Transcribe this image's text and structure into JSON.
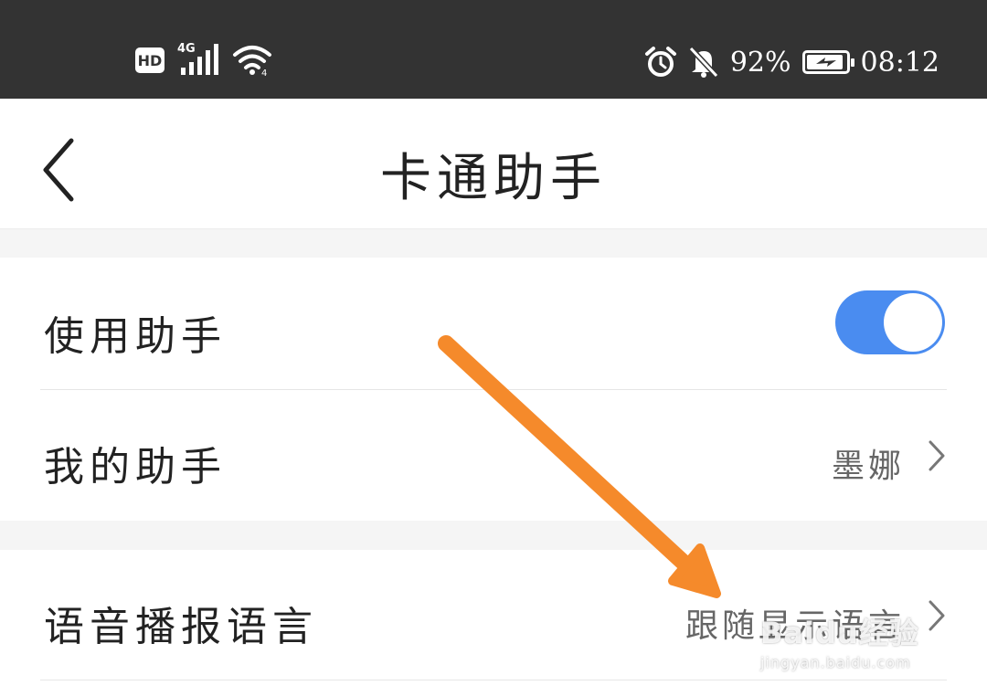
{
  "status_bar": {
    "hd_label": "HD",
    "network_label": "4G",
    "battery_percent": "92%",
    "time": "08:12",
    "icons": [
      "hd-icon",
      "signal-icon",
      "wifi-icon",
      "alarm-icon",
      "mute-icon",
      "battery-charging-icon"
    ]
  },
  "header": {
    "title": "卡通助手"
  },
  "settings": {
    "use_assistant": {
      "label": "使用助手",
      "enabled": true
    },
    "my_assistant": {
      "label": "我的助手",
      "value": "墨娜"
    },
    "voice_language": {
      "label": "语音播报语言",
      "value": "跟随显示语言"
    }
  },
  "overlay": {
    "arrow_color": "#f58a2b",
    "watermark_brand": "Baidu经验",
    "watermark_url": "jingyan.baidu.com"
  },
  "colors": {
    "toggle_on": "#4a8cf0",
    "status_bar_bg": "#333333",
    "page_bg": "#f5f5f5"
  }
}
